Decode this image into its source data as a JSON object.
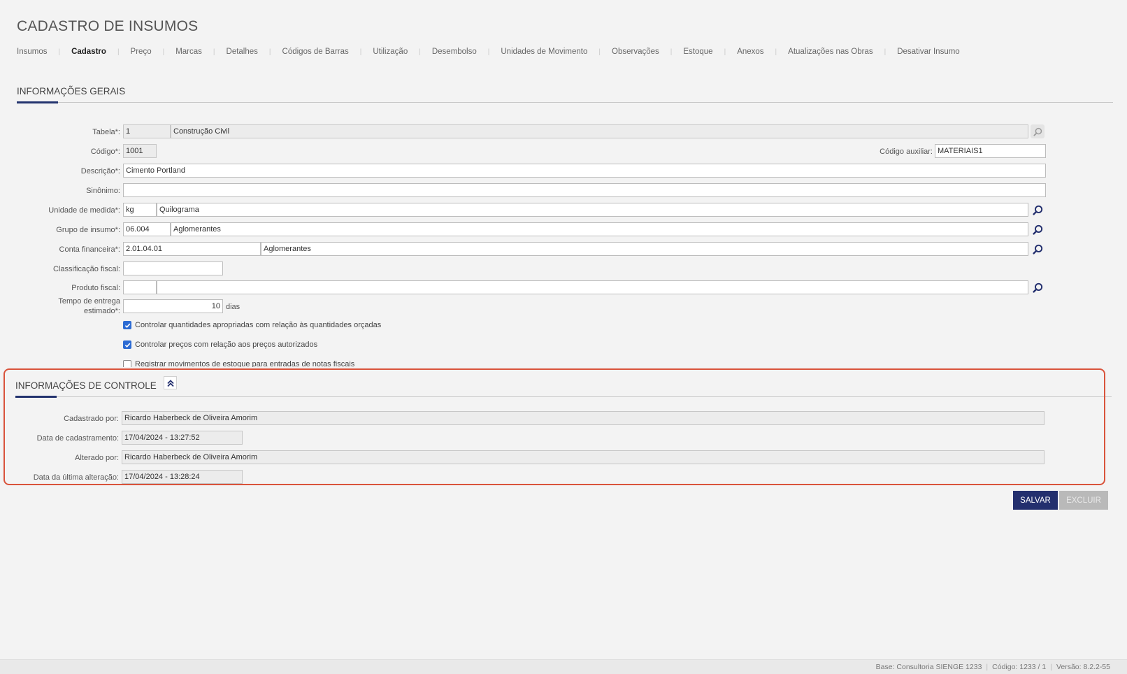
{
  "page": {
    "title": "CADASTRO DE INSUMOS"
  },
  "tabs": [
    {
      "label": "Insumos"
    },
    {
      "label": "Cadastro"
    },
    {
      "label": "Preço"
    },
    {
      "label": "Marcas"
    },
    {
      "label": "Detalhes"
    },
    {
      "label": "Códigos de Barras"
    },
    {
      "label": "Utilização"
    },
    {
      "label": "Desembolso"
    },
    {
      "label": "Unidades de Movimento"
    },
    {
      "label": "Observações"
    },
    {
      "label": "Estoque"
    },
    {
      "label": "Anexos"
    },
    {
      "label": "Atualizações nas Obras"
    },
    {
      "label": "Desativar Insumo"
    }
  ],
  "active_tab": "Cadastro",
  "general": {
    "title": "INFORMAÇÕES GERAIS",
    "tabela": {
      "label": "Tabela*:",
      "code": "1",
      "name": "Construção Civil"
    },
    "codigo": {
      "label": "Código*:",
      "value": "1001"
    },
    "codigo_auxiliar": {
      "label": "Código auxiliar:",
      "value": "MATERIAIS1"
    },
    "descricao": {
      "label": "Descrição*:",
      "value": "Cimento Portland"
    },
    "sinonimo": {
      "label": "Sinônimo:",
      "value": ""
    },
    "unidade": {
      "label": "Unidade de medida*:",
      "code": "kg",
      "name": "Quilograma"
    },
    "grupo": {
      "label": "Grupo de insumo*:",
      "code": "06.004",
      "name": "Aglomerantes"
    },
    "conta": {
      "label": "Conta financeira*:",
      "code": "2.01.04.01",
      "name": "Aglomerantes"
    },
    "classificacao": {
      "label": "Classificação fiscal:",
      "value": ""
    },
    "produto": {
      "label": "Produto fiscal:",
      "code": "",
      "name": ""
    },
    "tempo": {
      "label_line1": "Tempo de entrega",
      "label_line2": "estimado*:",
      "value": "10",
      "unit": "dias"
    },
    "checks": [
      {
        "label": "Controlar quantidades apropriadas com relação às quantidades orçadas",
        "checked": true
      },
      {
        "label": "Controlar preços com relação aos preços autorizados",
        "checked": true
      },
      {
        "label": "Registrar movimentos de estoque para entradas de notas fiscais",
        "checked": false
      }
    ]
  },
  "control": {
    "title": "INFORMAÇÕES DE CONTROLE",
    "cadastrado_por": {
      "label": "Cadastrado por:",
      "value": "Ricardo Haberbeck de Oliveira Amorim"
    },
    "data_cadastramento": {
      "label": "Data de cadastramento:",
      "value": "17/04/2024 - 13:27:52"
    },
    "alterado_por": {
      "label": "Alterado por:",
      "value": "Ricardo Haberbeck de Oliveira Amorim"
    },
    "data_alteracao": {
      "label": "Data da última alteração:",
      "value": "17/04/2024 - 13:28:24"
    }
  },
  "actions": {
    "save": "SALVAR",
    "delete": "EXCLUIR"
  },
  "footer": {
    "base": "Base: Consultoria SIENGE 1233",
    "codigo": "Código: 1233 / 1",
    "versao": "Versão: 8.2.2-55"
  },
  "colors": {
    "primary": "#232f6e",
    "highlight": "#d9533b",
    "checkbox": "#2c6bd3"
  }
}
